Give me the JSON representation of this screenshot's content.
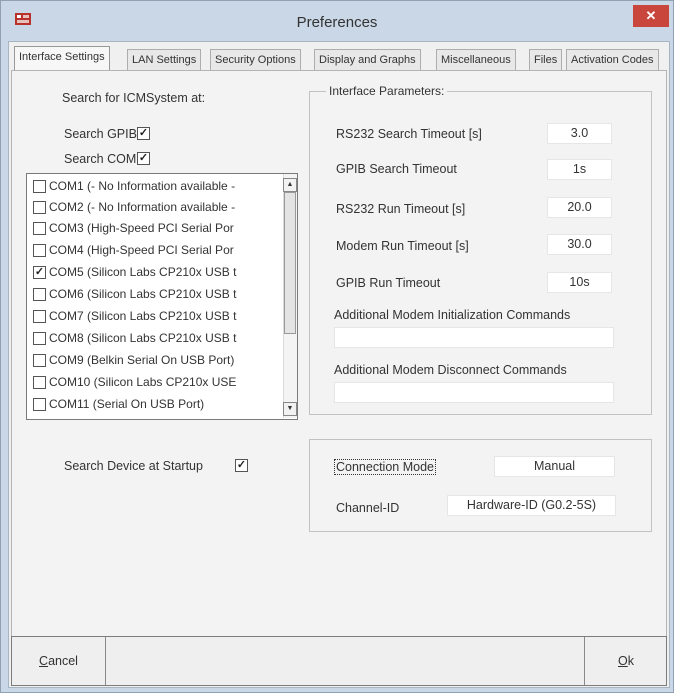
{
  "window": {
    "title": "Preferences",
    "close_label": "✕"
  },
  "tabs": [
    {
      "label": "Interface Settings",
      "active": true
    },
    {
      "label": "LAN Settings"
    },
    {
      "label": "Security Options"
    },
    {
      "label": "Display and Graphs"
    },
    {
      "label": "Miscellaneous"
    },
    {
      "label": "Files"
    },
    {
      "label": "Activation Codes"
    }
  ],
  "search": {
    "heading": "Search for ICMSystem at:",
    "gpib_label": "Search GPIB",
    "gpib_checked": true,
    "com_label": "Search COM",
    "com_checked": true,
    "startup_label": "Search Device at Startup",
    "startup_checked": true
  },
  "com_ports": [
    {
      "label": "COM1 (- No Information available -",
      "checked": false
    },
    {
      "label": "COM2 (- No Information available -",
      "checked": false
    },
    {
      "label": "COM3 (High-Speed PCI Serial Por",
      "checked": false
    },
    {
      "label": "COM4 (High-Speed PCI Serial Por",
      "checked": false
    },
    {
      "label": "COM5 (Silicon Labs CP210x USB t",
      "checked": true
    },
    {
      "label": "COM6 (Silicon Labs CP210x USB t",
      "checked": false
    },
    {
      "label": "COM7 (Silicon Labs CP210x USB t",
      "checked": false
    },
    {
      "label": "COM8 (Silicon Labs CP210x USB t",
      "checked": false
    },
    {
      "label": "COM9 (Belkin Serial On USB Port)",
      "checked": false
    },
    {
      "label": "COM10 (Silicon Labs CP210x USE",
      "checked": false
    },
    {
      "label": "COM11 (Serial On USB Port)",
      "checked": false
    }
  ],
  "interface_params": {
    "legend": "Interface Parameters:",
    "rs232_search_label": "RS232 Search Timeout [s]",
    "rs232_search_value": "3.0",
    "gpib_search_label": "GPIB Search Timeout",
    "gpib_search_value": "1s",
    "rs232_run_label": "RS232 Run Timeout [s]",
    "rs232_run_value": "20.0",
    "modem_run_label": "Modem Run Timeout [s]",
    "modem_run_value": "30.0",
    "gpib_run_label": "GPIB Run Timeout",
    "gpib_run_value": "10s",
    "modem_init_label": "Additional Modem Initialization Commands",
    "modem_init_value": "",
    "modem_disconnect_label": "Additional Modem Disconnect Commands",
    "modem_disconnect_value": ""
  },
  "connection": {
    "mode_label": "Connection Mode",
    "mode_value": "Manual",
    "channel_label": "Channel-ID",
    "channel_value": "Hardware-ID (G0.2-5S)"
  },
  "buttons": {
    "cancel_prefix": "C",
    "cancel_rest": "ancel",
    "ok_prefix": "O",
    "ok_rest": "k"
  }
}
